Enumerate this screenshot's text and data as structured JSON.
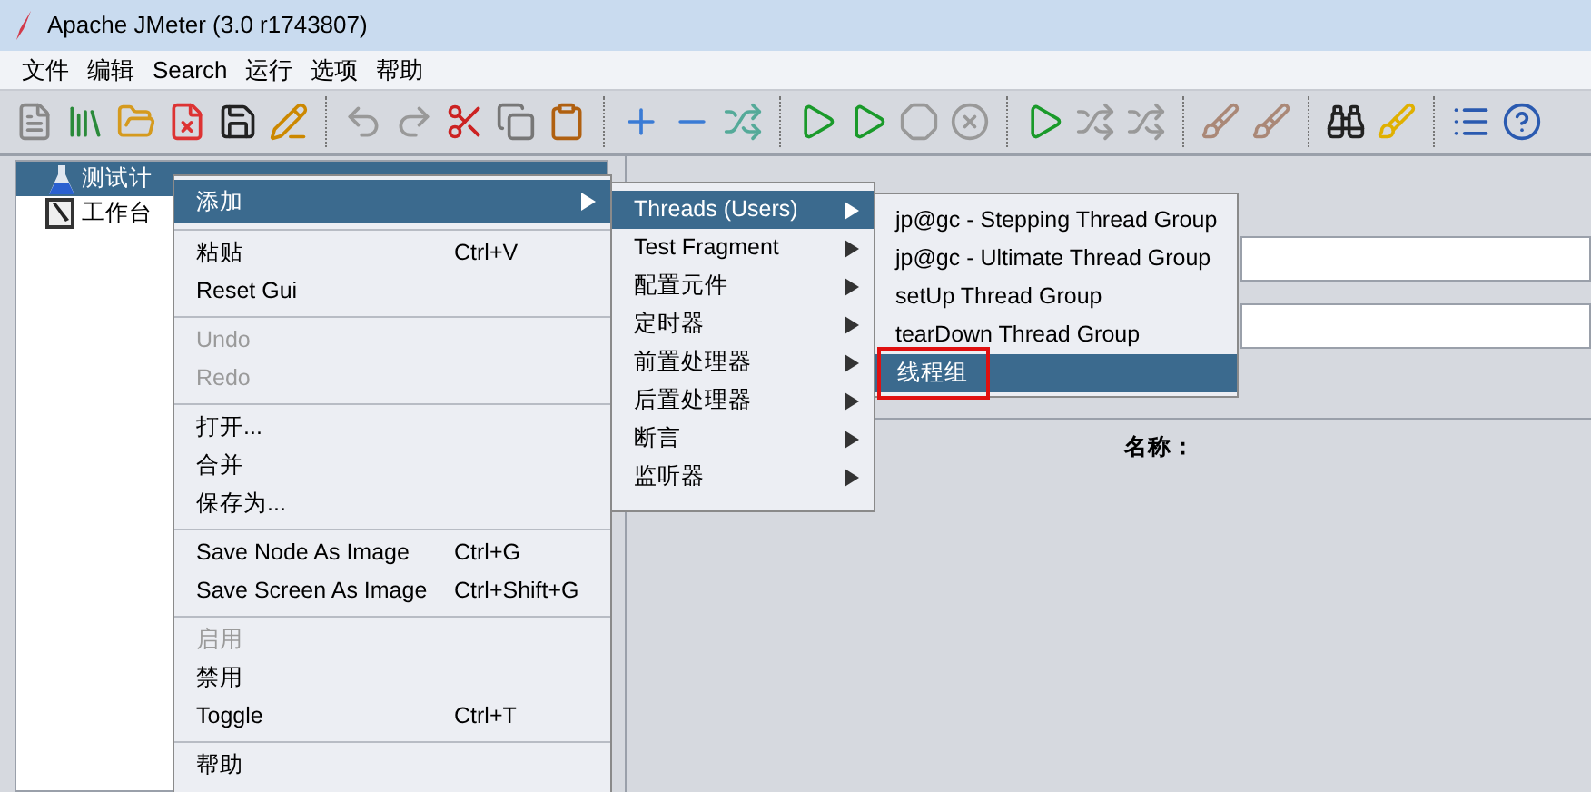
{
  "window": {
    "title": "Apache JMeter (3.0 r1743807)"
  },
  "menubar": [
    "文件",
    "编辑",
    "Search",
    "运行",
    "选项",
    "帮助"
  ],
  "tree": [
    {
      "label": "测试计",
      "kind": "plan",
      "selected": true
    },
    {
      "label": "工作台",
      "kind": "workbench",
      "selected": false
    }
  ],
  "context_menu": [
    {
      "kind": "item",
      "label": "添加",
      "selected": true,
      "disabled": false,
      "submenu": true
    },
    {
      "kind": "separator"
    },
    {
      "kind": "item",
      "label": "粘贴",
      "shortcut": "Ctrl+V",
      "selected": false,
      "disabled": false,
      "submenu": false
    },
    {
      "kind": "item",
      "label": "Reset Gui",
      "selected": false,
      "disabled": false,
      "submenu": false
    },
    {
      "kind": "separator"
    },
    {
      "kind": "item",
      "label": "Undo",
      "selected": false,
      "disabled": true,
      "submenu": false
    },
    {
      "kind": "item",
      "label": "Redo",
      "selected": false,
      "disabled": true,
      "submenu": false
    },
    {
      "kind": "separator"
    },
    {
      "kind": "item",
      "label": "打开...",
      "selected": false,
      "disabled": false,
      "submenu": false
    },
    {
      "kind": "item",
      "label": "合并",
      "selected": false,
      "disabled": false,
      "submenu": false
    },
    {
      "kind": "item",
      "label": "保存为...",
      "selected": false,
      "disabled": false,
      "submenu": false
    },
    {
      "kind": "separator"
    },
    {
      "kind": "item",
      "label": "Save Node As Image",
      "shortcut": "Ctrl+G",
      "selected": false,
      "disabled": false,
      "submenu": false
    },
    {
      "kind": "item",
      "label": "Save Screen As Image",
      "shortcut": "Ctrl+Shift+G",
      "selected": false,
      "disabled": false,
      "submenu": false
    },
    {
      "kind": "separator"
    },
    {
      "kind": "item",
      "label": "启用",
      "selected": false,
      "disabled": true,
      "submenu": false
    },
    {
      "kind": "item",
      "label": "禁用",
      "selected": false,
      "disabled": false,
      "submenu": false
    },
    {
      "kind": "item",
      "label": "Toggle",
      "shortcut": "Ctrl+T",
      "selected": false,
      "disabled": false,
      "submenu": false
    },
    {
      "kind": "separator"
    },
    {
      "kind": "item",
      "label": "帮助",
      "selected": false,
      "disabled": false,
      "submenu": false
    }
  ],
  "add_submenu": [
    {
      "label": "Threads (Users)",
      "selected": true
    },
    {
      "label": "Test Fragment",
      "selected": false
    },
    {
      "label": "配置元件",
      "selected": false
    },
    {
      "label": "定时器",
      "selected": false
    },
    {
      "label": "前置处理器",
      "selected": false
    },
    {
      "label": "后置处理器",
      "selected": false
    },
    {
      "label": "断言",
      "selected": false
    },
    {
      "label": "监听器",
      "selected": false
    }
  ],
  "threads_submenu": [
    {
      "label": "jp@gc - Stepping Thread Group",
      "selected": false,
      "outlined": false
    },
    {
      "label": "jp@gc - Ultimate Thread Group",
      "selected": false,
      "outlined": false
    },
    {
      "label": "setUp Thread Group",
      "selected": false,
      "outlined": false
    },
    {
      "label": "tearDown Thread Group",
      "selected": false,
      "outlined": false
    },
    {
      "label": "线程组",
      "selected": true,
      "outlined": true
    }
  ],
  "editor": {
    "name_label": "名称："
  }
}
